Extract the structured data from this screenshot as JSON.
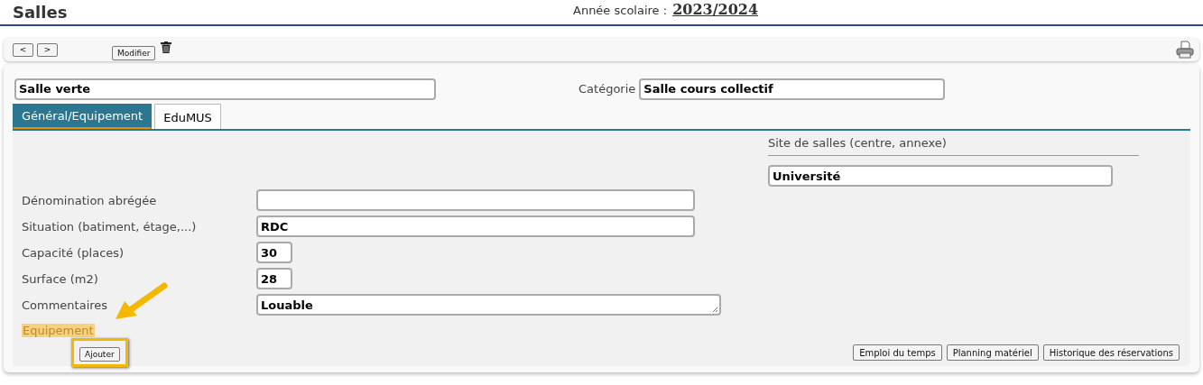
{
  "page": {
    "title": "Salles",
    "year_label": "Année scolaire :",
    "year": "2023/2024"
  },
  "toolbar": {
    "prev": "<",
    "next": ">",
    "edit": "Modifier"
  },
  "room": {
    "name": "Salle verte",
    "category_label": "Catégorie",
    "category": "Salle cours collectif"
  },
  "tabs": [
    {
      "label": "Général/Equipement",
      "selected": true
    },
    {
      "label": "EduMUS",
      "selected": false
    }
  ],
  "site": {
    "label": "Site de salles (centre, annexe)",
    "value": "Université"
  },
  "fields": [
    {
      "label": "Dénomination abrégée",
      "kind": "wide"
    },
    {
      "label": "Situation (batiment, étage,...)",
      "value": "RDC",
      "kind": "wide"
    },
    {
      "label": "Capacité (places)",
      "value": "30",
      "kind": "short"
    },
    {
      "label": "Surface (m2)",
      "value": "28",
      "kind": "short"
    },
    {
      "label": "Commentaires",
      "value": "Louable",
      "kind": "textarea"
    }
  ],
  "equipment": {
    "label": "Equipement",
    "highlighted": true,
    "add_button": "Ajouter",
    "add_highlighted": true
  },
  "actions": [
    "Emploi du temps",
    "Planning matériel",
    "Historique des réservations"
  ]
}
